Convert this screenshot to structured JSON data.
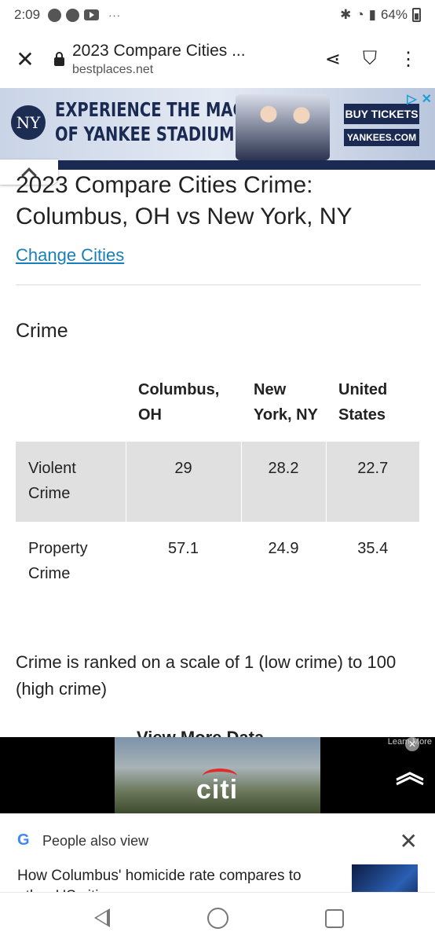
{
  "status_bar": {
    "time": "2:09",
    "overflow": "···",
    "battery": "64%"
  },
  "browser": {
    "page_title": "2023 Compare Cities ...",
    "domain": "bestplaces.net"
  },
  "top_ad": {
    "headline_line1": "EXPERIENCE THE MAGIC",
    "headline_line2": "OF YANKEE STADIUM",
    "buy_label": "BUY TICKETS",
    "site_label": "YANKEES.COM"
  },
  "page": {
    "title": "2023 Compare Cities Crime: Columbus, OH vs New York, NY",
    "change_link": "Change Cities",
    "section_heading": "Crime",
    "table": {
      "columns": [
        "",
        "Columbus, OH",
        "New York, NY",
        "United States"
      ],
      "rows": [
        {
          "label": "Violent Crime",
          "values": [
            "29",
            "28.2",
            "22.7"
          ]
        },
        {
          "label": "Property Crime",
          "values": [
            "57.1",
            "24.9",
            "35.4"
          ]
        }
      ]
    },
    "note": "Crime is ranked on a scale of 1 (low crime) to 100 (high crime)",
    "peek_text": "View More Data"
  },
  "bottom_ad": {
    "brand": "citi",
    "ad_choices": "AdChoices",
    "learn_more": "Learn More"
  },
  "people_also_view": {
    "label": "People also view",
    "story": "How Columbus' homicide rate compares to other US cities"
  }
}
